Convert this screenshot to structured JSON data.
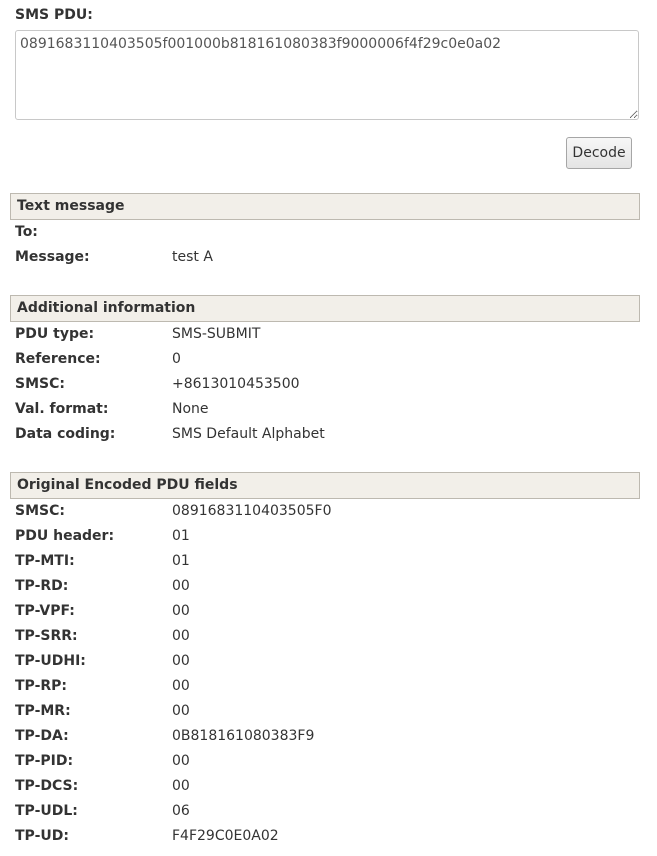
{
  "input": {
    "label": "SMS PDU:",
    "value": "0891683110403505f001000b818161080383f9000006f4f29c0e0a02",
    "button_label": "Decode"
  },
  "text_message": {
    "title": "Text message",
    "rows": [
      {
        "label": "To:",
        "value": ""
      },
      {
        "label": "Message:",
        "value": "test A"
      }
    ]
  },
  "additional_info": {
    "title": "Additional information",
    "rows": [
      {
        "label": "PDU type:",
        "value": "SMS-SUBMIT"
      },
      {
        "label": "Reference:",
        "value": "0"
      },
      {
        "label": "SMSC:",
        "value": "+8613010453500"
      },
      {
        "label": "Val. format:",
        "value": "None"
      },
      {
        "label": "Data coding:",
        "value": "SMS Default Alphabet"
      }
    ]
  },
  "encoded_fields": {
    "title": "Original Encoded PDU fields",
    "rows": [
      {
        "label": "SMSC:",
        "value": "0891683110403505F0"
      },
      {
        "label": "PDU header:",
        "value": "01"
      },
      {
        "label": "TP-MTI:",
        "value": "01"
      },
      {
        "label": "TP-RD:",
        "value": "00"
      },
      {
        "label": "TP-VPF:",
        "value": "00"
      },
      {
        "label": "TP-SRR:",
        "value": "00"
      },
      {
        "label": "TP-UDHI:",
        "value": "00"
      },
      {
        "label": "TP-RP:",
        "value": "00"
      },
      {
        "label": "TP-MR:",
        "value": "00"
      },
      {
        "label": "TP-DA:",
        "value": "0B818161080383F9"
      },
      {
        "label": "TP-PID:",
        "value": "00"
      },
      {
        "label": "TP-DCS:",
        "value": "00"
      },
      {
        "label": "TP-UDL:",
        "value": "06"
      },
      {
        "label": "TP-UD:",
        "value": "F4F29C0E0A02"
      }
    ]
  }
}
